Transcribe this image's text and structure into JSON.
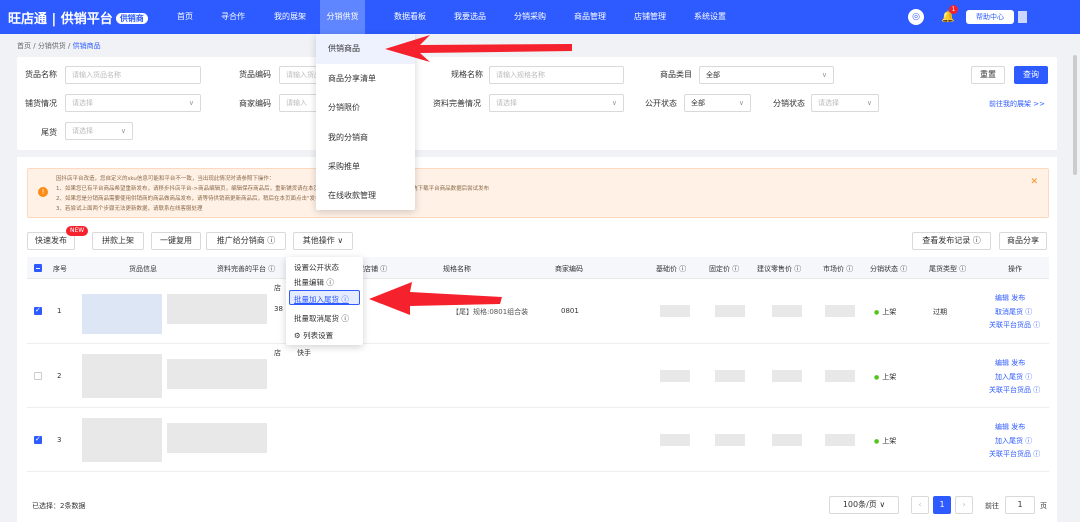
{
  "header": {
    "logo": "旺店通 | 供销平台",
    "logo_badge": "供销商",
    "nav": [
      "首页",
      "寻合作",
      "我的展架",
      "分销供货",
      "数据看板",
      "我要选品",
      "分销采购",
      "商品管理",
      "店铺管理",
      "系统设置"
    ],
    "notif_count": "1",
    "help": "帮助中心"
  },
  "breadcrumb": {
    "a": "首页",
    "b": "分销供货",
    "c": "供销商品"
  },
  "filters": {
    "goods_name": "货品名称",
    "goods_name_ph": "请输入货品名称",
    "goods_code": "货品编码",
    "goods_code_ph": "请输入货品",
    "spec_name": "规格名称",
    "spec_name_ph": "请输入规格名称",
    "category": "商品类目",
    "category_val": "全部",
    "reset": "重置",
    "query": "查询",
    "dist": "铺货情况",
    "dist_ph": "请选择",
    "merchant_code": "商家编码",
    "merchant_code_ph": "请输入",
    "info": "资料完善情况",
    "info_ph": "请选择",
    "public": "公开状态",
    "public_val": "全部",
    "dist_status": "分销状态",
    "dist_status_ph": "请选择",
    "goto_shelf": "前往我的展架 >>",
    "tail": "尾货",
    "tail_ph": "请选择"
  },
  "notice": [
    "因抖店平台改造，您自定义的sku信息可能和平台不一致，当出现此情况时请参照下操作：",
    "1、如果您已有平台商品希望重新发布，请移步抖店平台->商品编辑页，编辑保存商品后，重新铺货请在本页面查找到对应商品，点击\"编辑\"等待系统下载平台商品数据后尝试发布",
    "2、如果您是分销商品需要使用供销商的商品做商品发布，请等待供销商更新商品后，稍后在本页面点击\"发布\"后尝试发布",
    "3、若尝试上面两个步骤无法更新数据，请联系在线客服处理"
  ],
  "toolbar": {
    "quick": "快速发布",
    "new": "NEW",
    "batch": "拼款上架",
    "copy": "一键复用",
    "promote": "推广给分销商 ⓘ",
    "more": "其他操作 ∨",
    "history": "查看发布记录 ⓘ",
    "share": "商品分享"
  },
  "table": {
    "headers": [
      "序号",
      "货品信息",
      "资料完善的平台 ⓘ",
      "架店铺 ⓘ",
      "规格名称",
      "商家编码",
      "基础价 ⓘ",
      "固定价 ⓘ",
      "建议零售价 ⓘ",
      "市场价 ⓘ",
      "分销状态 ⓘ",
      "尾货类型 ⓘ",
      "操作"
    ],
    "rows": [
      {
        "n": "1",
        "spec": "【尾】规格:0801组合装",
        "code": "0801",
        "status": "上架",
        "tail": "过期",
        "op1": "编辑  发布",
        "op2": "取消尾货 ⓘ",
        "op3": "关联平台货品 ⓘ"
      },
      {
        "n": "2",
        "spec": "",
        "code": "",
        "status": "上架",
        "tail": "",
        "op1": "编辑  发布",
        "op2": "加入尾货 ⓘ",
        "op3": "关联平台货品 ⓘ"
      },
      {
        "n": "3",
        "spec": "",
        "code": "",
        "status": "上架",
        "tail": "",
        "op1": "编辑  发布",
        "op2": "加入尾货 ⓘ",
        "op3": "关联平台货品 ⓘ"
      }
    ],
    "frag_store": "店",
    "frag_num": "38",
    "frag_store2": "店",
    "frag_ks": "快手"
  },
  "menu_supply": [
    "供销商品",
    "商品分享清单",
    "分销限价",
    "我的分销商",
    "采购推单",
    "在线收款管理"
  ],
  "menu_more": [
    "设置公开状态",
    "批量编辑 ⓘ",
    "批量加入尾货 ⓘ",
    "批量取消尾货 ⓘ",
    "⚙ 列表设置"
  ],
  "footer": {
    "selected": "已选择：2条数据",
    "per_page": "100条/页",
    "page": "1",
    "goto": "前往",
    "goto_val": "1",
    "page_unit": "页"
  }
}
